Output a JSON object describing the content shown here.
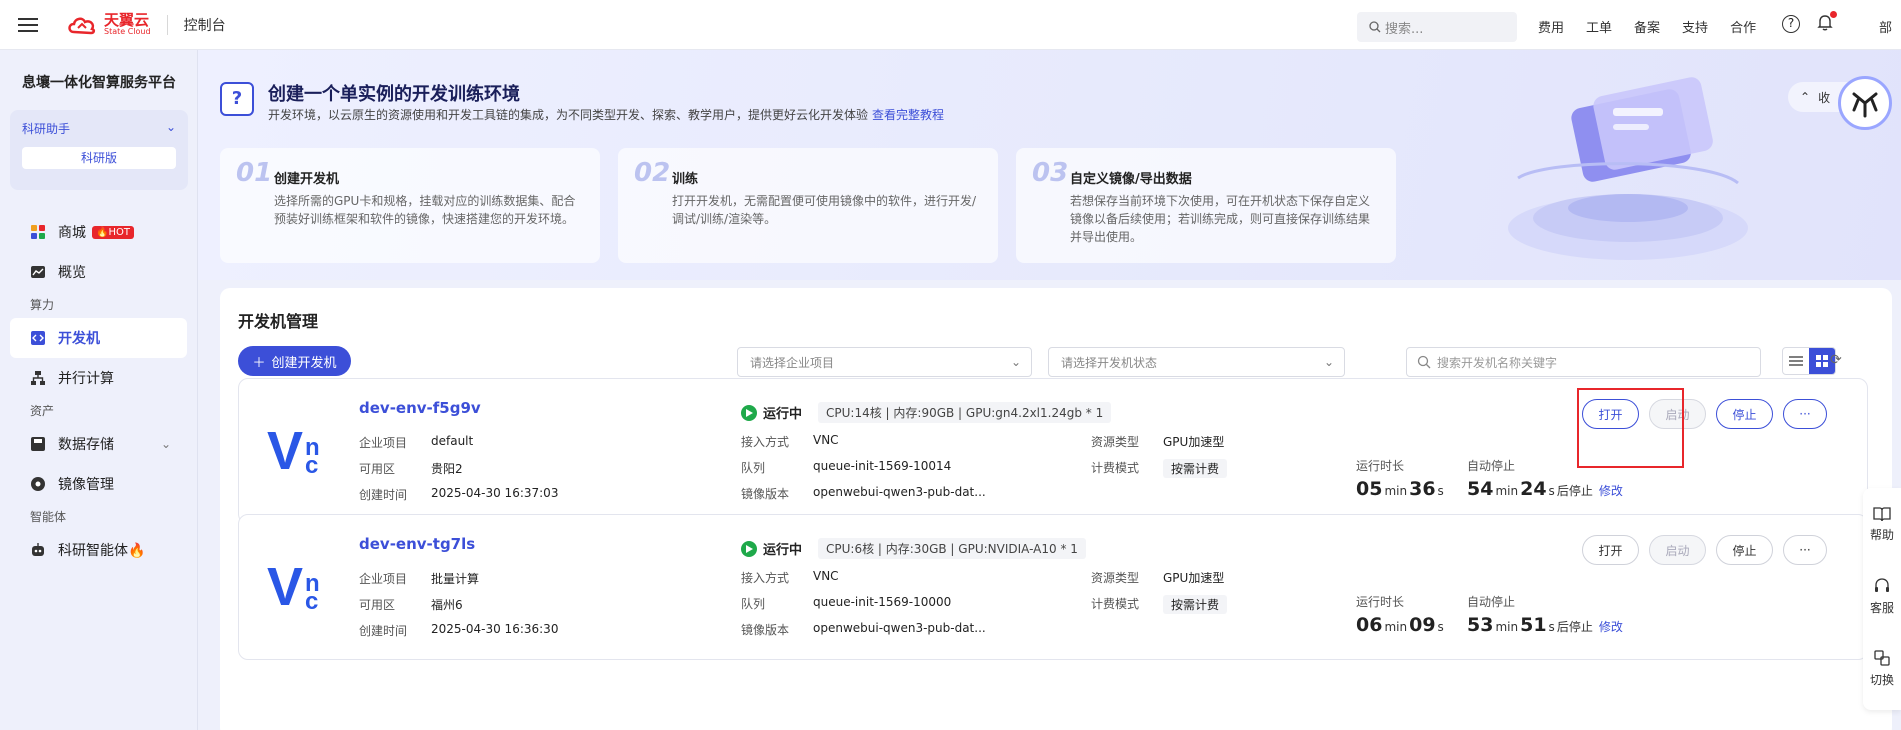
{
  "topbar": {
    "brand": "天翼云",
    "brand_sub": "State Cloud",
    "console": "控制台",
    "search_placeholder": "搜索...",
    "links": [
      "费用",
      "工单",
      "备案",
      "支持",
      "合作"
    ],
    "user_partial": "部"
  },
  "sidebar": {
    "platform_title": "息壤一体化智算服务平台",
    "assistant_label": "科研助手",
    "edition": "科研版",
    "items": [
      {
        "label": "商城",
        "badge": "HOT"
      },
      {
        "label": "概览"
      }
    ],
    "group_compute": "算力",
    "compute_items": [
      {
        "label": "开发机"
      },
      {
        "label": "并行计算"
      }
    ],
    "group_assets": "资产",
    "asset_items": [
      {
        "label": "数据存储"
      },
      {
        "label": "镜像管理"
      }
    ],
    "group_agent": "智能体",
    "agent_items": [
      {
        "label": "科研智能体🔥"
      }
    ]
  },
  "hero": {
    "title": "创建一个单实例的开发训练环境",
    "desc": "开发环境，以云原生的资源使用和开发工具链的集成，为不同类型开发、探索、教学用户，提供更好云化开发体验",
    "link": "查看完整教程",
    "collapse": "收",
    "steps": [
      {
        "num": "01",
        "title": "创建开发机",
        "desc": "选择所需的GPU卡和规格，挂载对应的训练数据集、配合预装好训练框架和软件的镜像，快速搭建您的开发环境。"
      },
      {
        "num": "02",
        "title": "训练",
        "desc": "打开开发机，无需配置便可使用镜像中的软件，进行开发/调试/训练/渲染等。"
      },
      {
        "num": "03",
        "title": "自定义镜像/导出数据",
        "desc": "若想保存当前环境下次使用，可在开机状态下保存自定义镜像以备后续使用；若训练完成，则可直接保存训练结果并导出使用。"
      }
    ]
  },
  "panel": {
    "title": "开发机管理",
    "create_label": "创建开发机",
    "select_project_placeholder": "请选择企业项目",
    "select_status_placeholder": "请选择开发机状态",
    "search_placeholder": "搜索开发机名称关键字"
  },
  "labels": {
    "project": "企业项目",
    "zone": "可用区",
    "created": "创建时间",
    "access": "接入方式",
    "queue": "队列",
    "image": "镜像版本",
    "res_type": "资源类型",
    "billing": "计费模式",
    "runtime": "运行时长",
    "autostop": "自动停止",
    "open": "打开",
    "start": "启动",
    "stop": "停止",
    "more": "···",
    "min": "min",
    "s": "s",
    "after_stop": "后停止",
    "modify": "修改"
  },
  "machines": [
    {
      "name": "dev-env-f5g9v",
      "project": "default",
      "zone": "贵阳2",
      "created": "2025-04-30 16:37:03",
      "status": "运行中",
      "spec": "CPU:14核 | 内存:90GB | GPU:gn4.2xl1.24gb * 1",
      "access": "VNC",
      "queue": "queue-init-1569-10014",
      "image": "openwebui-qwen3-pub-dat...",
      "res_type": "GPU加速型",
      "billing": "按需计费",
      "runtime_min": "05",
      "runtime_s": "36",
      "stop_min": "54",
      "stop_s": "24"
    },
    {
      "name": "dev-env-tg7ls",
      "project": "批量计算",
      "zone": "福州6",
      "created": "2025-04-30 16:36:30",
      "status": "运行中",
      "spec": "CPU:6核 | 内存:30GB | GPU:NVIDIA-A10 * 1",
      "access": "VNC",
      "queue": "queue-init-1569-10000",
      "image": "openwebui-qwen3-pub-dat...",
      "res_type": "GPU加速型",
      "billing": "按需计费",
      "runtime_min": "06",
      "runtime_s": "09",
      "stop_min": "53",
      "stop_s": "51"
    }
  ],
  "dock": [
    "帮助",
    "客服",
    "切换"
  ]
}
